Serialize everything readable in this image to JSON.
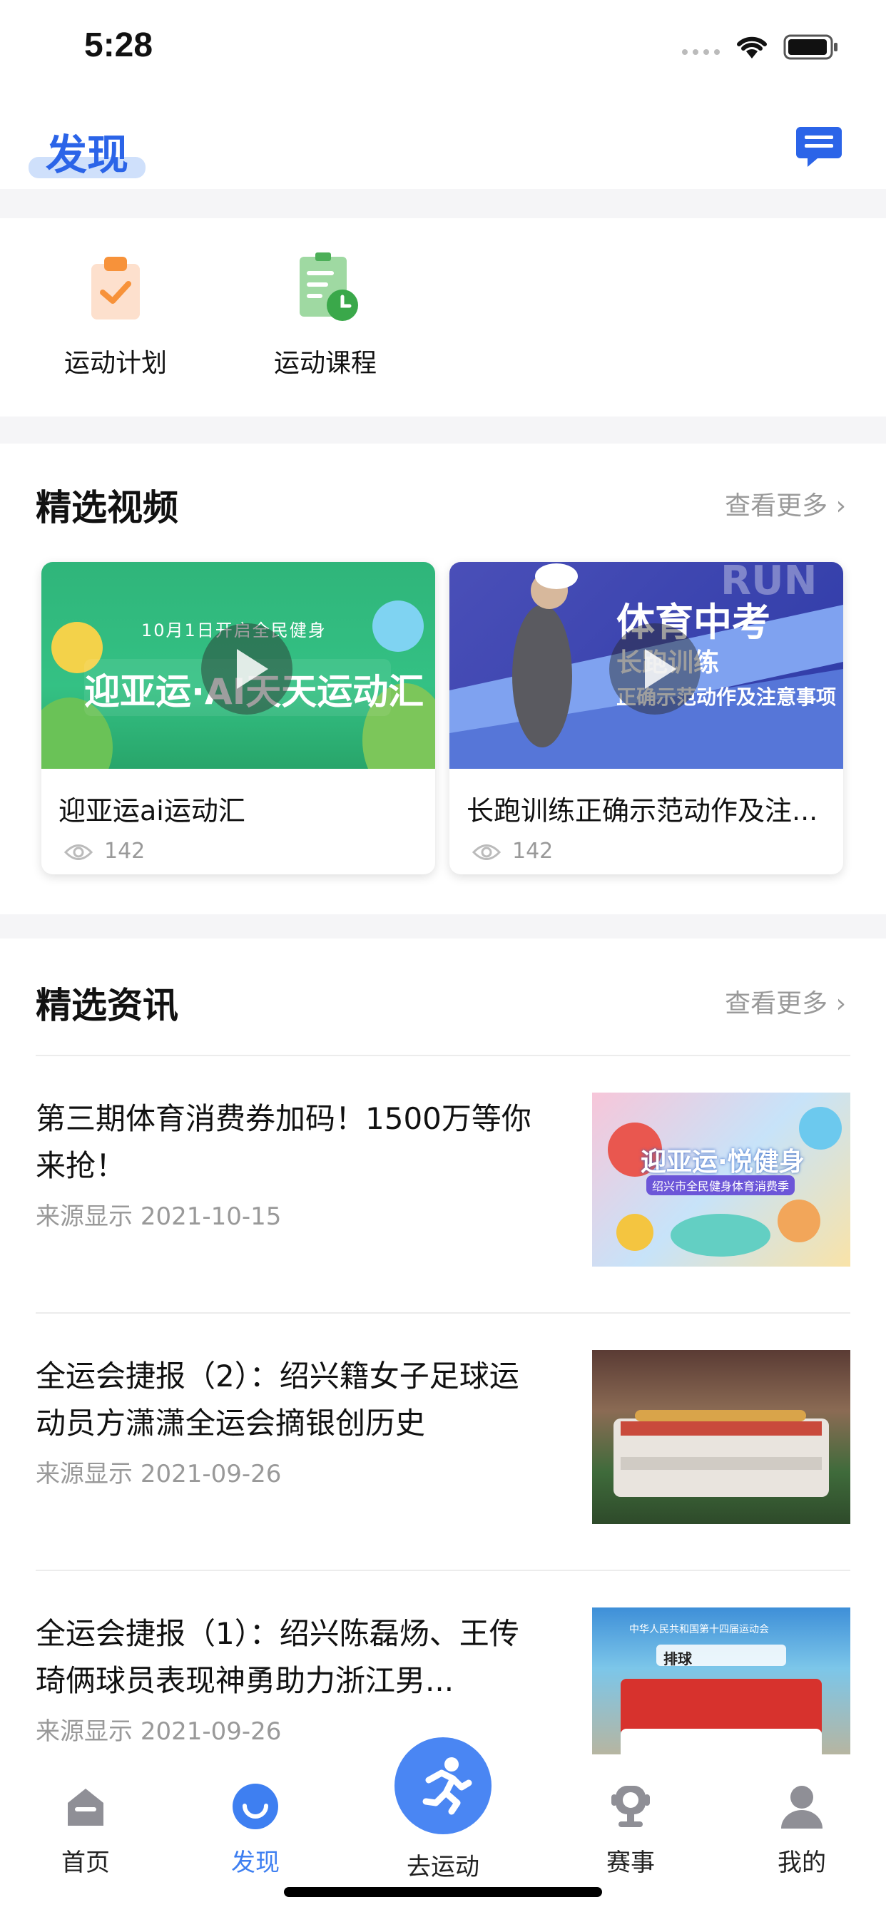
{
  "status_bar": {
    "time": "5:28"
  },
  "header": {
    "title": "发现",
    "message_icon": "message-icon"
  },
  "quick_entries": [
    {
      "label": "运动计划",
      "icon": "clipboard-check-icon"
    },
    {
      "label": "运动课程",
      "icon": "document-clock-icon"
    }
  ],
  "videos": {
    "section_title": "精选视频",
    "more_label": "查看更多 ›",
    "items": [
      {
        "title": "迎亚运ai运动汇",
        "views": "142",
        "thumb_caption": "10月1日开启全民健身",
        "thumb_headline": "迎亚运·AI天天运动汇"
      },
      {
        "title": "长跑训练正确示范动作及注...",
        "views": "142",
        "thumb_caption": "RUN",
        "thumb_headline": "体育中考",
        "thumb_sub": "长跑训练",
        "thumb_sub2": "正确示范动作及注意事项"
      }
    ]
  },
  "news": {
    "section_title": "精选资讯",
    "more_label": "查看更多 ›",
    "items": [
      {
        "title": "第三期体育消费券加码！1500万等你来抢！",
        "source": "来源显示",
        "date": "2021-10-15",
        "thumb_headline": "迎亚运·悦健身",
        "thumb_sub": "绍兴市全民健身体育消费季"
      },
      {
        "title": "全运会捷报（2）：绍兴籍女子足球运动员方潇潇全运会摘银创历史",
        "source": "来源显示",
        "date": "2021-09-26"
      },
      {
        "title": "全运会捷报（1）：绍兴陈磊炀、王传琦俩球员表现神勇助力浙江男...",
        "source": "来源显示",
        "date": "2021-09-26",
        "thumb_headline": "中华人民共和国第十四届运动会",
        "thumb_sub": "排球"
      }
    ]
  },
  "tabbar": {
    "items": [
      {
        "label": "首页",
        "icon": "home-icon"
      },
      {
        "label": "发现",
        "icon": "discover-icon",
        "active": true
      },
      {
        "label": "去运动",
        "icon": "running-icon"
      },
      {
        "label": "赛事",
        "icon": "trophy-icon"
      },
      {
        "label": "我的",
        "icon": "profile-icon"
      }
    ]
  },
  "colors": {
    "accent": "#2b64e8",
    "tab_active": "#3e7ff1",
    "muted": "#999999"
  }
}
